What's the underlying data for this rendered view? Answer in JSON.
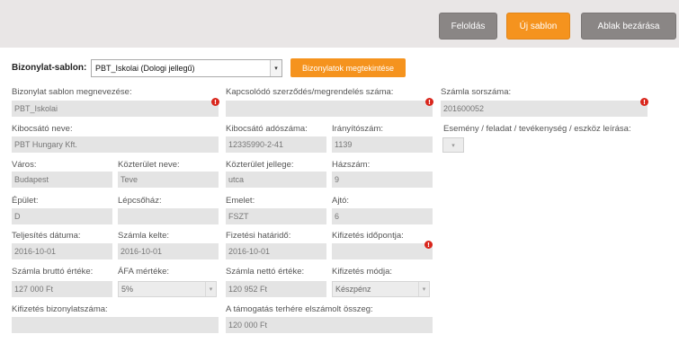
{
  "toolbar": {
    "release_label": "Feloldás",
    "new_template_label": "Új sablon",
    "close_window_label": "Ablak bezárása"
  },
  "template_select": {
    "label": "Bizonylat-sablon:",
    "value": "PBT_Iskolai (Dologi jellegű)",
    "view_button": "Bizonylatok megtekintése"
  },
  "fields": {
    "template_name": {
      "label": "Bizonylat sablon megnevezése:",
      "value": "PBT_Iskolai"
    },
    "contract_number": {
      "label": "Kapcsolódó szerződés/megrendelés száma:",
      "value": ""
    },
    "invoice_serial": {
      "label": "Számla sorszáma:",
      "value": "201600052"
    },
    "issuer_name": {
      "label": "Kibocsátó neve:",
      "value": "PBT Hungary Kft."
    },
    "issuer_tax_number": {
      "label": "Kibocsátó adószáma:",
      "value": "12335990-2-41"
    },
    "postal_code": {
      "label": "Irányítószám:",
      "value": "1139"
    },
    "event_description": {
      "label": "Esemény / feladat / tevékenység / eszköz leírása:",
      "value": ""
    },
    "city": {
      "label": "Város:",
      "value": "Budapest"
    },
    "street_name": {
      "label": "Közterület neve:",
      "value": "Teve"
    },
    "street_type": {
      "label": "Közterület jellege:",
      "value": "utca"
    },
    "house_number": {
      "label": "Házszám:",
      "value": "9"
    },
    "building": {
      "label": "Épület:",
      "value": "D"
    },
    "staircase": {
      "label": "Lépcsőház:",
      "value": ""
    },
    "floor": {
      "label": "Emelet:",
      "value": "FSZT"
    },
    "door": {
      "label": "Ajtó:",
      "value": "6"
    },
    "completion_date": {
      "label": "Teljesítés dátuma:",
      "value": "2016-10-01"
    },
    "invoice_date": {
      "label": "Számla kelte:",
      "value": "2016-10-01"
    },
    "payment_deadline": {
      "label": "Fizetési határidő:",
      "value": "2016-10-01"
    },
    "payment_time": {
      "label": "Kifizetés időpontja:",
      "value": ""
    },
    "gross_amount": {
      "label": "Számla bruttó értéke:",
      "value": "127 000 Ft"
    },
    "vat_rate": {
      "label": "ÁFA mértéke:",
      "value": "5%"
    },
    "net_amount": {
      "label": "Számla nettó értéke:",
      "value": "120 952 Ft"
    },
    "payment_method": {
      "label": "Kifizetés módja:",
      "value": "Készpénz"
    },
    "payment_doc_number": {
      "label": "Kifizetés bizonylatszáma:",
      "value": ""
    },
    "subsidy_amount": {
      "label": "A támogatás terhére elszámolt összeg:",
      "value": "120 000 Ft"
    }
  },
  "icons": {
    "warning": "!",
    "dropdown": "▾"
  },
  "colors": {
    "accent": "#f5931e",
    "secondary_button": "#8a8685",
    "warning": "#d9261c"
  }
}
